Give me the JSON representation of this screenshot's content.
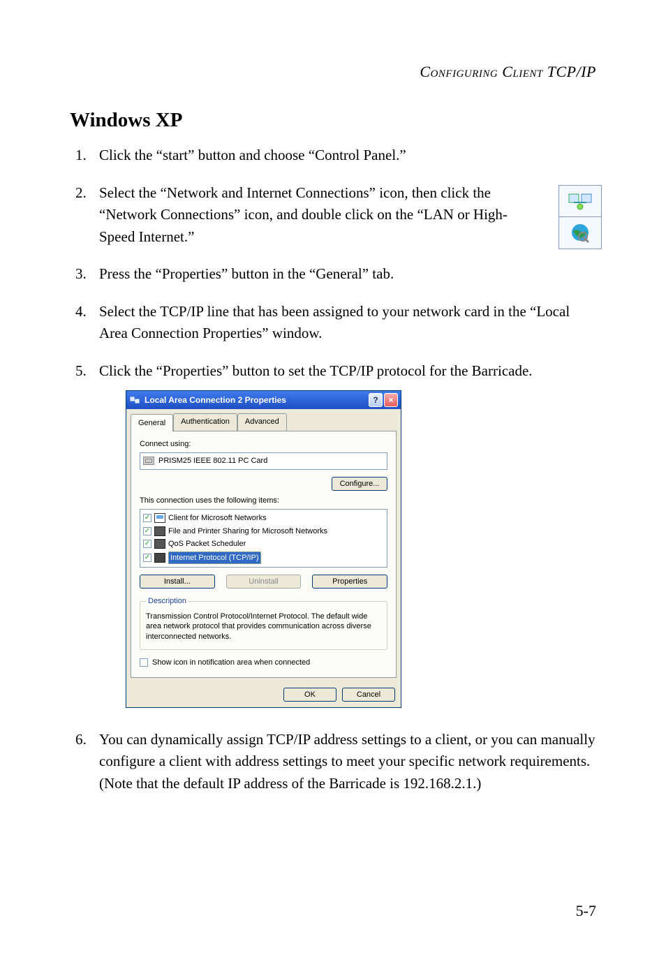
{
  "page_header": "Configuring Client TCP/IP",
  "section_heading": "Windows XP",
  "steps": [
    {
      "num": "1.",
      "text": "Click the “start” button and choose “Control Panel.”"
    },
    {
      "num": "2.",
      "text": "Select the “Network and Internet Connections” icon, then click the “Network Connections” icon, and double click on the “LAN or High-Speed Internet.”"
    },
    {
      "num": "3.",
      "text": "Press the “Properties” button in the “General” tab."
    },
    {
      "num": "4.",
      "text": "Select the TCP/IP line that has been assigned to your network card in the “Local Area Connection Properties” window."
    },
    {
      "num": "5.",
      "text": "Click the “Properties” button to set the TCP/IP protocol for the Barricade."
    },
    {
      "num": "6.",
      "text": "You can dynamically assign TCP/IP address settings to a client, or you can manually configure a client with address settings to meet your specific network requirements. (Note that the default IP address of the Barricade is 192.168.2.1.)"
    }
  ],
  "dialog": {
    "title": "Local Area Connection 2 Properties",
    "help": "?",
    "close": "×",
    "tabs": [
      "General",
      "Authentication",
      "Advanced"
    ],
    "connect_using_label": "Connect using:",
    "adapter": "PRISM25 IEEE 802.11 PC Card",
    "configure_btn": "Configure...",
    "items_label": "This connection uses the following items:",
    "items": [
      "Client for Microsoft Networks",
      "File and Printer Sharing for Microsoft Networks",
      "QoS Packet Scheduler",
      "Internet Protocol (TCP/IP)"
    ],
    "install_btn": "Install...",
    "uninstall_btn": "Uninstall",
    "properties_btn": "Properties",
    "desc_legend": "Description",
    "desc_text": "Transmission Control Protocol/Internet Protocol. The default wide area network protocol that provides communication across diverse interconnected networks.",
    "show_icon_label": "Show icon in notification area when connected",
    "ok_btn": "OK",
    "cancel_btn": "Cancel"
  },
  "page_number": "5-7"
}
